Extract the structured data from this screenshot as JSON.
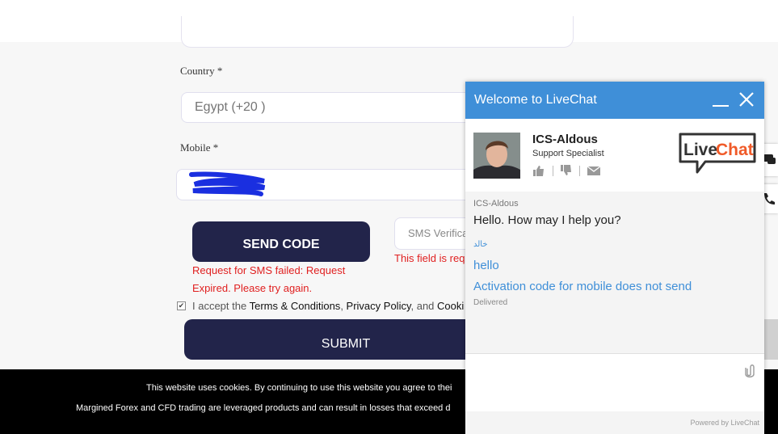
{
  "form": {
    "country_label": "Country *",
    "country_value": "Egypt (+20 )",
    "mobile_label": "Mobile *",
    "send_code_label": "SEND CODE",
    "sms_placeholder": "SMS Verifica",
    "sms_error": "This field is req",
    "sms_failed_line1": "Request for SMS failed: Request",
    "sms_failed_line2": "Expired. Please try again.",
    "terms_prefix": "I accept the ",
    "terms_link": "Terms & Conditions",
    "terms_sep1": ", ",
    "privacy_link": "Privacy Policy",
    "terms_sep2": ", and ",
    "cookie_link": "Cooki",
    "submit_label": "SUBMIT"
  },
  "cookie_bar": {
    "line1": "This website uses cookies. By continuing to use this website you agree to thei",
    "line2": "Margined Forex and CFD trading are leveraged products and can result in losses that exceed d"
  },
  "chat": {
    "title": "Welcome to LiveChat",
    "agent_name": "ICS-Aldous",
    "agent_role": "Support Specialist",
    "logo_text": "LiveChat",
    "messages": {
      "agent_author": "ICS-Aldous",
      "agent_text": "Hello. How may I help you?",
      "visitor_name": "خالد",
      "visitor_msg_1": "hello",
      "visitor_msg_2": "Activation code for mobile does not send",
      "status": "Delivered"
    },
    "powered_by": "Powered by LiveChat"
  },
  "colors": {
    "chat_header": "#3f8fd8",
    "button_dark": "#22244a",
    "error_red": "#e02020",
    "logo_orange": "#f05a28"
  }
}
